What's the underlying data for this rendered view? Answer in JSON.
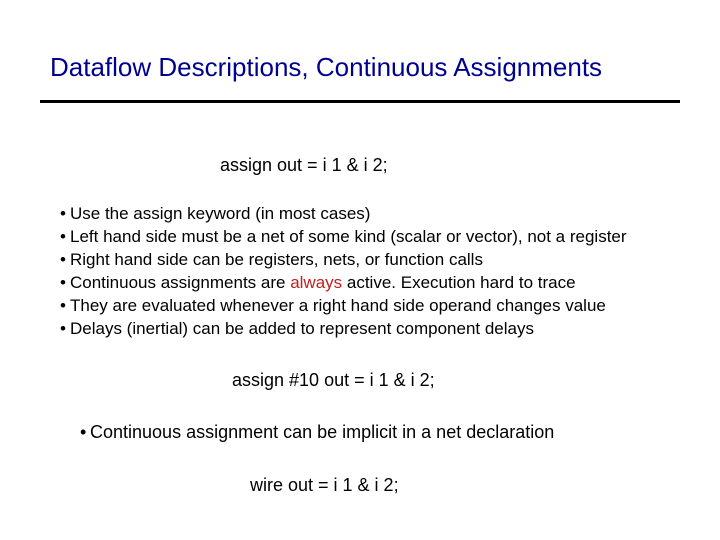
{
  "title": "Dataflow Descriptions, Continuous Assignments",
  "code1": "assign out = i 1 & i 2;",
  "b1": {
    "i1": "Use the assign keyword (in most cases)",
    "i2": "Left hand side must be a net of some kind (scalar or vector), not a register",
    "i3": "Right hand side can be registers, nets, or function calls",
    "i4a": "Continuous assignments are ",
    "i4b": "always",
    "i4c": " active. Execution hard to trace",
    "i5": "They are evaluated whenever a right hand side operand changes value",
    "i6": "Delays (inertial) can be added to represent component delays"
  },
  "code2": "assign #10 out = i 1 & i 2;",
  "b2": "Continuous assignment can be implicit in a net declaration",
  "code3": "wire out = i 1 & i 2;",
  "bullet": "•"
}
